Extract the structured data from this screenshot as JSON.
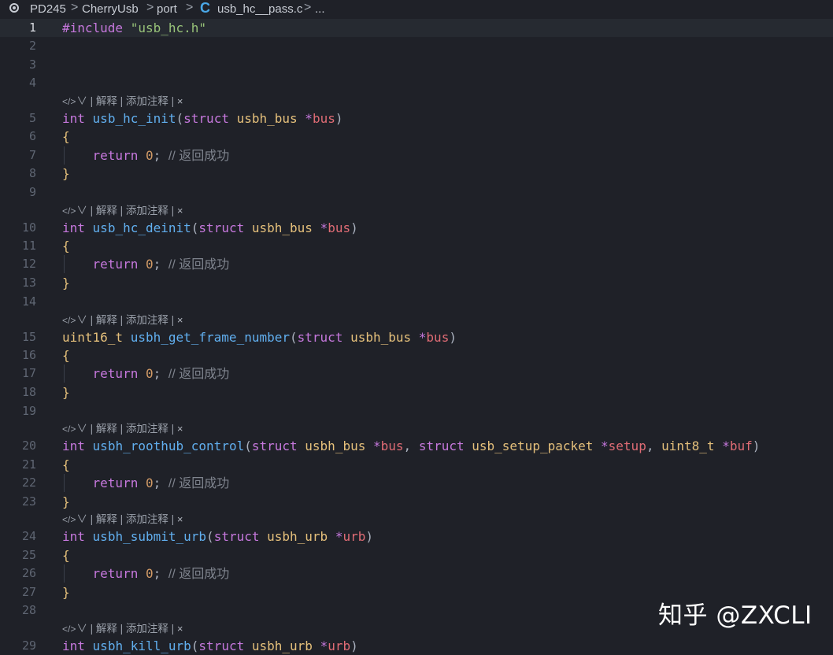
{
  "breadcrumb": {
    "items": [
      "PD245",
      "CherryUsb",
      "port",
      "usb_hc__pass.c",
      "..."
    ],
    "separator": ">"
  },
  "codelens": {
    "icon": "code-lens-icon",
    "chevron": "∨",
    "text": "| 解释 | 添加注释 | ",
    "close": "×"
  },
  "code": {
    "include_directive": "#include",
    "include_file": "\"usb_hc.h\"",
    "open_brace": "{",
    "close_brace": "}",
    "return_kw": "return",
    "zero": "0",
    "semicolon": ";",
    "comment": "// 返回成功",
    "int": "int",
    "uint16": "uint16_t",
    "uint8": "uint8_t",
    "struct": "struct",
    "star": "*",
    "comma": ",",
    "paren_open": "(",
    "paren_close": ")",
    "type_bus": "usbh_bus",
    "type_urb": "usbh_urb",
    "type_setup": "usb_setup_packet",
    "param_bus": "bus",
    "param_urb": "urb",
    "param_setup": "setup",
    "param_buf": "buf",
    "functions": [
      "usb_hc_init",
      "usb_hc_deinit",
      "usbh_get_frame_number",
      "usbh_roothub_control",
      "usbh_submit_urb",
      "usbh_kill_urb"
    ]
  },
  "line_numbers": [
    "1",
    "2",
    "3",
    "4",
    "5",
    "6",
    "7",
    "8",
    "9",
    "10",
    "11",
    "12",
    "13",
    "14",
    "15",
    "16",
    "17",
    "18",
    "19",
    "20",
    "21",
    "22",
    "23",
    "24",
    "25",
    "26",
    "27",
    "28",
    "29"
  ],
  "watermark": "知乎 @ZXCLI",
  "colors": {
    "background": "#1f2128",
    "keyword": "#c678dd",
    "type": "#e5c07b",
    "function": "#61afef",
    "parameter": "#e06c75",
    "number": "#d19a66",
    "string": "#98c379",
    "comment": "#7f848e"
  }
}
